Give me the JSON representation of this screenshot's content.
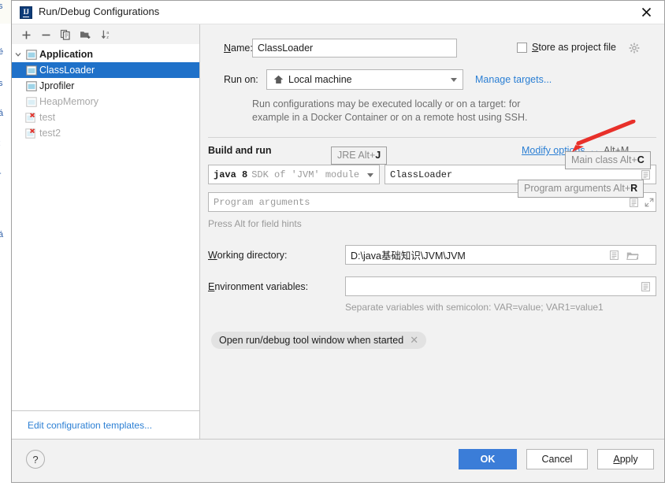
{
  "window": {
    "title": "Run/Debug Configurations",
    "app_icon": "intellij-idea-icon",
    "close_icon": "close-icon"
  },
  "sidebar": {
    "toolbar": [
      {
        "name": "add-configuration-button",
        "icon": "plus-icon",
        "label": "+"
      },
      {
        "name": "remove-configuration-button",
        "icon": "minus-icon",
        "label": "−"
      },
      {
        "name": "copy-configuration-button",
        "icon": "copy-icon",
        "label": "Copy"
      },
      {
        "name": "new-folder-button",
        "icon": "new-folder-icon",
        "label": "New Folder"
      },
      {
        "name": "sort-configurations-button",
        "icon": "sort-alphabetically-icon",
        "label": "Sort"
      }
    ],
    "tree": [
      {
        "label": "Application",
        "type": "group",
        "icon": "application-icon",
        "selected": false,
        "dim": false,
        "error": false,
        "expanded": true
      },
      {
        "label": "ClassLoader",
        "type": "item",
        "icon": "application-icon",
        "selected": true,
        "dim": false,
        "error": false
      },
      {
        "label": "Jprofiler",
        "type": "item",
        "icon": "application-icon",
        "selected": false,
        "dim": false,
        "error": false
      },
      {
        "label": "HeapMemory",
        "type": "item",
        "icon": "application-icon",
        "selected": false,
        "dim": true,
        "error": false
      },
      {
        "label": "test",
        "type": "item",
        "icon": "application-error-icon",
        "selected": false,
        "dim": true,
        "error": true
      },
      {
        "label": "test2",
        "type": "item",
        "icon": "application-error-icon",
        "selected": false,
        "dim": true,
        "error": true
      }
    ],
    "edit_templates_label": "Edit configuration templates..."
  },
  "form": {
    "name_label": "Name:",
    "name_value": "ClassLoader",
    "store_as_project_file_label": "Store as project file",
    "store_as_project_file_checked": false,
    "store_gear_icon": "gear-icon",
    "run_on_label": "Run on:",
    "run_on_value": "Local machine",
    "run_on_icon": "home-icon",
    "manage_targets_label": "Manage targets...",
    "target_help_line1": "Run configurations may be executed locally or on a target: for",
    "target_help_line2": "example in a Docker Container or on a remote host using SSH.",
    "build_and_run_label": "Build and run",
    "modify_options_label": "Modify options",
    "modify_options_shortcut": "Alt+M",
    "jre_value_bold": "java 8",
    "jre_value_grey": "SDK of 'JVM' module",
    "main_class_value": "ClassLoader",
    "program_arguments_placeholder": "Program arguments",
    "field_hints_text": "Press Alt for field hints",
    "working_directory_label": "Working directory:",
    "working_directory_value": "D:\\java基础知识\\JVM\\JVM",
    "environment_variables_label": "Environment variables:",
    "environment_variables_value": "",
    "environment_variables_help": "Separate variables with semicolon: VAR=value; VAR1=value1",
    "chip_label": "Open run/debug tool window when started",
    "chip_close_icon": "close-small-icon",
    "icons": {
      "main_class_expand": "list-expand-icon",
      "program_args_expand": "list-expand-icon",
      "program_args_fullscreen": "expand-editor-icon",
      "working_dir_expand": "list-expand-icon",
      "working_dir_browse": "folder-browse-icon",
      "env_vars_expand": "list-expand-icon"
    }
  },
  "tooltips": [
    {
      "name": "tooltip-jre",
      "text": "JRE Alt+",
      "key": "J"
    },
    {
      "name": "tooltip-main-class",
      "text": "Main class Alt+",
      "key": "C"
    },
    {
      "name": "tooltip-program-arguments",
      "text": "Program arguments Alt+",
      "key": "R"
    }
  ],
  "footer": {
    "help_label": "?",
    "ok_label": "OK",
    "cancel_label": "Cancel",
    "apply_label": "Apply"
  },
  "annotation": {
    "arrow_color": "#e8302a",
    "points_to": "modify-options-link"
  },
  "background_bleed": {
    "fragments": [
      "s",
      "é",
      "s",
      "á",
      ":",
      "-",
      "á"
    ]
  },
  "colors": {
    "selection_blue": "#1f71c9",
    "link_blue": "#2b7fd4",
    "primary_button": "#3b7dd8",
    "dialog_bg": "#f2f2f2",
    "error_red": "#e0312a"
  }
}
